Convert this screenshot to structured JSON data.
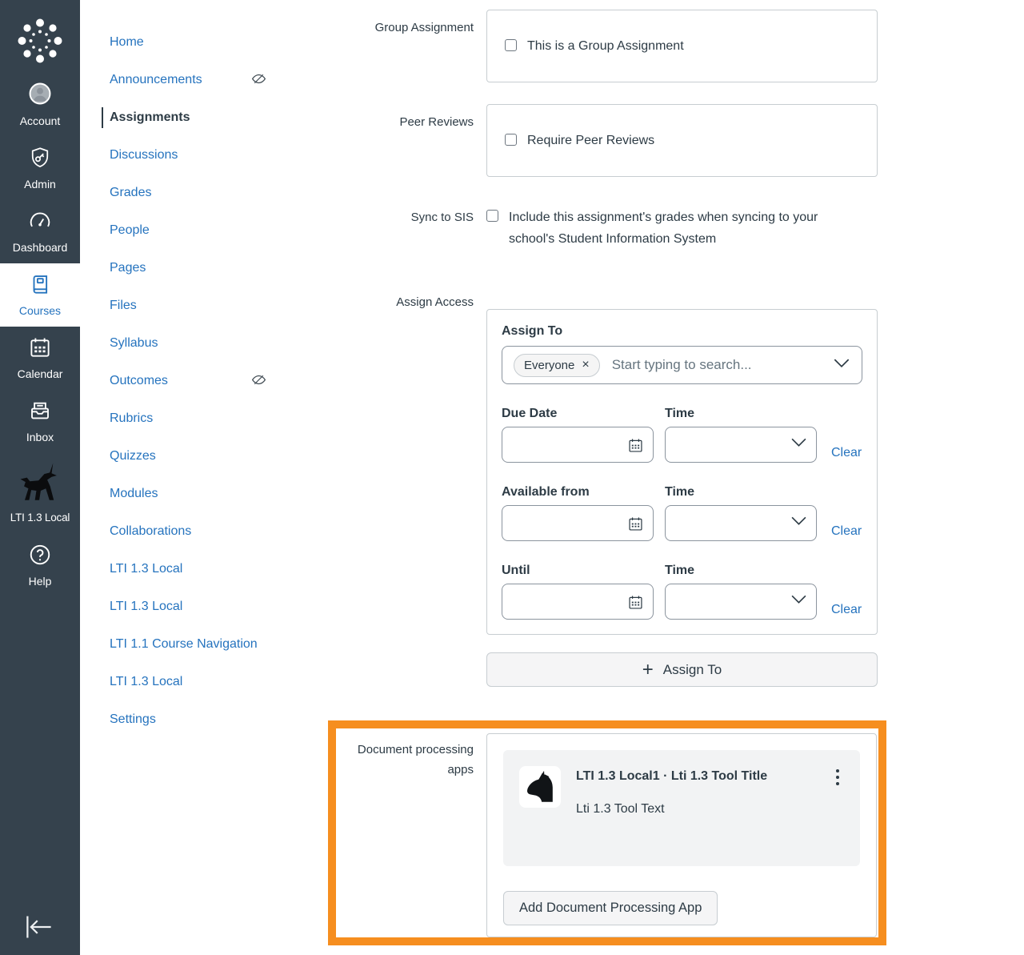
{
  "colors": {
    "sidebar_bg": "#35424D",
    "link_blue": "#2573BE",
    "text_dark": "#2D3B45",
    "highlight_orange": "#F68E1F",
    "border_light": "#C7CDD1",
    "border_input": "#8B949E",
    "button_gray": "#F5F5F6"
  },
  "sidebar": {
    "items": [
      {
        "label": "Account",
        "icon": "avatar-icon"
      },
      {
        "label": "Admin",
        "icon": "shield-key-icon"
      },
      {
        "label": "Dashboard",
        "icon": "gauge-icon"
      },
      {
        "label": "Courses",
        "icon": "book-icon",
        "active": true
      },
      {
        "label": "Calendar",
        "icon": "calendar-icon"
      },
      {
        "label": "Inbox",
        "icon": "inbox-icon"
      },
      {
        "label": "LTI 1.3 Local",
        "icon": "unicorn-icon"
      },
      {
        "label": "Help",
        "icon": "question-icon"
      }
    ],
    "collapse": "collapse-left-arrow"
  },
  "course_nav": {
    "items": [
      {
        "label": "Home"
      },
      {
        "label": "Announcements",
        "hidden_indicator": true
      },
      {
        "label": "Assignments",
        "active": true
      },
      {
        "label": "Discussions"
      },
      {
        "label": "Grades"
      },
      {
        "label": "People"
      },
      {
        "label": "Pages"
      },
      {
        "label": "Files"
      },
      {
        "label": "Syllabus"
      },
      {
        "label": "Outcomes",
        "hidden_indicator": true
      },
      {
        "label": "Rubrics"
      },
      {
        "label": "Quizzes"
      },
      {
        "label": "Modules"
      },
      {
        "label": "Collaborations"
      },
      {
        "label": "LTI 1.3 Local"
      },
      {
        "label": "LTI 1.3 Local"
      },
      {
        "label": "LTI 1.1 Course Navigation"
      },
      {
        "label": "LTI 1.3 Local"
      },
      {
        "label": "Settings"
      }
    ]
  },
  "form": {
    "group_assignment": {
      "label": "Group Assignment",
      "checkbox_label": "This is a Group Assignment",
      "checked": false
    },
    "peer_reviews": {
      "label": "Peer Reviews",
      "checkbox_label": "Require Peer Reviews",
      "checked": false
    },
    "sync_to_sis": {
      "label": "Sync to SIS",
      "checkbox_label": "Include this assignment's grades when syncing to your school's Student Information System",
      "checked": false
    },
    "assign_access": {
      "label": "Assign Access",
      "heading": "Assign To",
      "selected_tag": "Everyone",
      "remove_tag": "×",
      "search_placeholder": "Start typing to search...",
      "rows": [
        {
          "date_label": "Due Date",
          "time_label": "Time",
          "date_value": "",
          "time_value": "",
          "clear_label": "Clear"
        },
        {
          "date_label": "Available from",
          "time_label": "Time",
          "date_value": "",
          "time_value": "",
          "clear_label": "Clear"
        },
        {
          "date_label": "Until",
          "time_label": "Time",
          "date_value": "",
          "time_value": "",
          "clear_label": "Clear"
        }
      ],
      "add_button_label": "Assign To",
      "add_button_plus": "+"
    },
    "document_processing": {
      "label": "Document processing apps",
      "card": {
        "title": "LTI 1.3 Local1 · Lti 1.3 Tool Title",
        "text": "Lti 1.3 Tool Text",
        "menu_icon": "kebab-menu"
      },
      "add_button_label": "Add Document Processing App"
    }
  }
}
